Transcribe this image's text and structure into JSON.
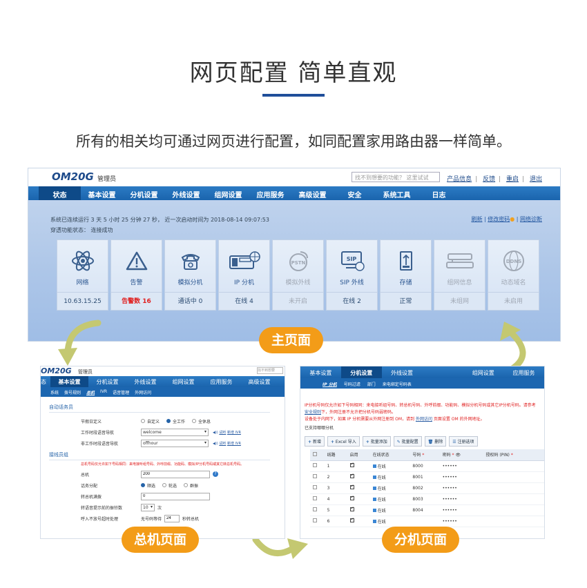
{
  "hero": {
    "title": "网页配置 简单直观",
    "subtitle": "所有的相关均可通过网页进行配置，如同配置家用路由器一样简单。"
  },
  "colors": {
    "accent": "#1f4e9a",
    "badge": "#f39c18",
    "nav": "#1a64ad",
    "arrow": "#c4c871"
  },
  "badges": {
    "main": "主页面",
    "pbx": "总机页面",
    "ext": "分机页面"
  },
  "main": {
    "logo": "OM20G",
    "role": "管理员",
    "search_placeholder": "找不到想要的功能？ 这里试试",
    "links": [
      "产品信息",
      "反馈",
      "重启",
      "退出"
    ],
    "nav": [
      "状态",
      "基本设置",
      "分机设置",
      "外线设置",
      "组网设置",
      "应用服务",
      "高级设置",
      "安全",
      "系统工具",
      "日志"
    ],
    "status_line1": "系统已连续运行 3 天 5 小时 25 分钟 27 秒，   近一次启动时间为 2018-08-14 09:07:53",
    "status_line2": "穿透功能状态： 连接成功",
    "right_links": [
      "刷新",
      "修改密码",
      "网络诊断"
    ],
    "tiles": [
      {
        "name": "网络",
        "value": "10.63.15.25",
        "icon": "network-icon"
      },
      {
        "name": "告警",
        "value": "告警数 16",
        "icon": "warning-icon"
      },
      {
        "name": "模拟分机",
        "value": "通话中 0",
        "icon": "phone-icon"
      },
      {
        "name": "IP 分机",
        "value": "在线 4",
        "icon": "ip-phone-icon"
      },
      {
        "name": "模拟外线",
        "value": "未开启",
        "icon": "pstn-icon"
      },
      {
        "name": "SIP 外线",
        "value": "在线 2",
        "icon": "sip-icon"
      },
      {
        "name": "存储",
        "value": "正常",
        "icon": "usb-icon"
      },
      {
        "name": "组网信息",
        "value": "未组网",
        "icon": "network-info-icon"
      },
      {
        "name": "动态域名",
        "value": "未启用",
        "icon": "ddns-icon"
      }
    ]
  },
  "pbx": {
    "logo": "OM20G",
    "role": "管理员",
    "search_placeholder": "找不到想要",
    "nav": [
      "态",
      "基本设置",
      "分机设置",
      "外线设置",
      "组网设置",
      "应用服务",
      "高级设置"
    ],
    "subnav": [
      "系统",
      "拨号规则",
      "总机",
      "IVR",
      "语音管理",
      "外网访问"
    ],
    "section1": "自动话务员",
    "rest_label": "节假日定义",
    "rest_options": [
      "自定义",
      "全工作",
      "全休息"
    ],
    "work_label": "工作时段语音导航",
    "work_value": "welcome",
    "offwork_label": "非工作时段语音导航",
    "offwork_value": "offhour",
    "audition": "试听",
    "new_ivr": "新增 IVR",
    "section2": "接线员组",
    "warning": "总机号码仅允许如下号码相同：来电接听组号码、外呼前缀、功能码、模拟/IP分机号码或其它转总机号码。",
    "pilot_label": "总机",
    "pilot_value": "200",
    "dist_label": "话务分配",
    "dist_options": [
      "顺选",
      "轮选",
      "群振"
    ],
    "busy_label": "转总机满拨",
    "busy_value": "0",
    "ring_label": "转语音提示前的振铃数",
    "ring_value": "10",
    "ring_unit": "次",
    "timeout_label": "呼入不放号超时处理",
    "timeout_text": "无号码等待",
    "timeout_value": "24",
    "timeout_unit": "秒转总机"
  },
  "ext": {
    "nav": [
      "基本设置",
      "分机设置",
      "外线设置",
      "",
      "组网设置",
      "应用服务"
    ],
    "subnav": [
      "IP 分机",
      "号码过滤",
      "部门",
      "来电绑定号码表"
    ],
    "warning": "IP分机号码仅允许如下号码相同：来电接听组号码、转总机号码、外呼前缀、功能码、模拟分机号码或其它IP分机号码。请参考",
    "warning_link": "安全规则",
    "warning_rest": "下，外网注册不允许把分机号码弱密码。",
    "warning2": "设备处于内网下，如果 IP 分机需要从外网注册到 OM，请到",
    "warning2_link": "外网访问",
    "warning2_rest": "页面设置 OM 的外网地址。",
    "note": "已支持哪哪分机",
    "toolbar": [
      "新增",
      "Excel 导入",
      "批量添加",
      "批量配置",
      "删除",
      "注册选项"
    ],
    "columns": [
      "",
      "线路",
      "启用",
      "在线状态",
      "号码",
      "密码",
      "授权码 (PIN)"
    ],
    "rows": [
      {
        "line": "1",
        "status": "在线",
        "number": "8000",
        "pwd": "••••••"
      },
      {
        "line": "2",
        "status": "在线",
        "number": "8001",
        "pwd": "••••••"
      },
      {
        "line": "3",
        "status": "在线",
        "number": "8002",
        "pwd": "••••••"
      },
      {
        "line": "4",
        "status": "在线",
        "number": "8003",
        "pwd": "••••••"
      },
      {
        "line": "5",
        "status": "在线",
        "number": "8004",
        "pwd": "••••••"
      },
      {
        "line": "6",
        "status": "在线",
        "number": "",
        "pwd": "••••••"
      }
    ]
  }
}
